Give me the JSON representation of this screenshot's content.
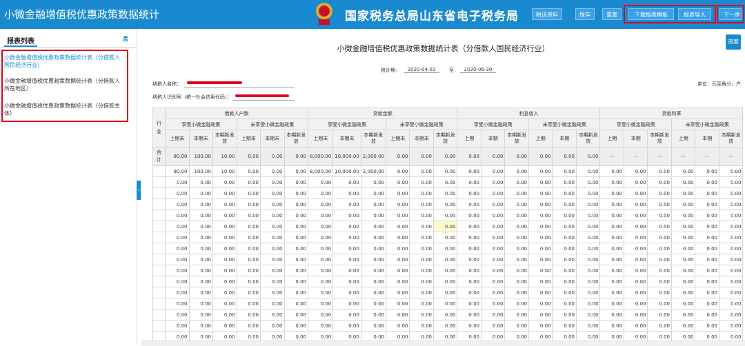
{
  "header": {
    "app_title": "小微金融增值税优惠政策数据统计",
    "bureau_title": "国家税务总局山东省电子税务局",
    "emblem_icon": "tax-emblem-icon",
    "buttons": [
      "附送资料",
      "保存",
      "重置",
      "下载报表模板",
      "报表导入",
      "下一步"
    ]
  },
  "sidebar": {
    "title": "报表列表",
    "items": [
      "小微金融增值税优惠政策数据统计表（分借款人国民经济行业）",
      "小微金融增值税优惠政策数据统计表（分借款人所在地区）",
      "小微金融增值税优惠政策数据统计表（分借款主体）"
    ]
  },
  "report": {
    "next_button": "进度",
    "title": "小微金融增值税优惠政策数据统计表（分借款人国民经济行业）",
    "period_label": "统计期:",
    "period_start": "2020-04-01",
    "period_sep": "至",
    "period_end": "2020-06-30",
    "unit": "单位：元至角分，户",
    "taxpayer_name_label": "纳税人名称：",
    "taxpayer_id_label": "纳税人识别号（统一社会信用代码）："
  },
  "table": {
    "row_header": "行业",
    "groups": [
      "借款人户数",
      "贷款金额",
      "利息收入",
      "贷款利率"
    ],
    "subgroups": [
      "享受小微金融政策",
      "未享受小微金融政策"
    ],
    "cols_a": [
      "上期末",
      "本期末",
      "本期新发放"
    ],
    "cols_b": [
      "上期",
      "本期",
      "本期新发放"
    ],
    "total_label": "合计",
    "total_row": [
      "90.00",
      "100.00",
      "10.00",
      "0.00",
      "0.00",
      "0.00",
      "8,000.00",
      "10,000.00",
      "2,000.00",
      "0.00",
      "0.00",
      "0.00",
      "0.00",
      "0.00",
      "0.00",
      "0.00",
      "0.00",
      "0.00",
      "--",
      "--",
      "--",
      "--",
      "--",
      "--"
    ],
    "row1": [
      "90.00",
      "100.00",
      "10.00",
      "0.00",
      "0.00",
      "0.00",
      "8,000.00",
      "10,000.00",
      "2,000.00",
      "0.00",
      "0.00",
      "0.00",
      "0.00",
      "0.00",
      "0.00",
      "0.00",
      "0.00",
      "0.00",
      "0.00",
      "0.00",
      "0.00",
      "0.00",
      "0.00",
      "0.00"
    ],
    "zero_value": "0.00",
    "zero_row_count": 15,
    "highlight_row": 5,
    "highlight_col": 11
  },
  "colors": {
    "header_blue": "#1a8ad0",
    "highlight_red": "#e0001a"
  }
}
